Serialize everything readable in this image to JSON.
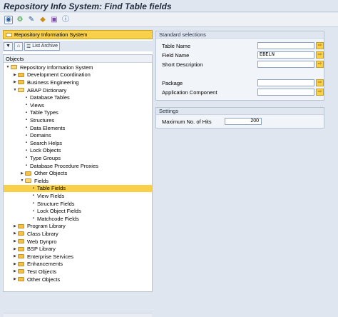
{
  "window": {
    "title": "Repository Info System: Find Table fields"
  },
  "toolbar": {
    "buttons": [
      {
        "icon": "execute-icon"
      },
      {
        "icon": "connections-icon"
      },
      {
        "icon": "display-toggle-icon"
      },
      {
        "icon": "other-object-icon"
      },
      {
        "icon": "where-used-icon"
      },
      {
        "icon": "info-icon"
      }
    ]
  },
  "nav": {
    "header_label": "Repository Information System",
    "list_archive_label": "List Archive"
  },
  "tree": {
    "title": "Objects",
    "items": [
      {
        "label": "Repository Information System",
        "level": 0,
        "type": "folder",
        "expanded": true
      },
      {
        "label": "Development Coordination",
        "level": 1,
        "type": "folder",
        "expanded": false
      },
      {
        "label": "Business Engineering",
        "level": 1,
        "type": "folder",
        "expanded": false
      },
      {
        "label": "ABAP Dictionary",
        "level": 1,
        "type": "folder",
        "expanded": true
      },
      {
        "label": "Database Tables",
        "level": 2,
        "type": "leaf"
      },
      {
        "label": "Views",
        "level": 2,
        "type": "leaf"
      },
      {
        "label": "Table Types",
        "level": 2,
        "type": "leaf"
      },
      {
        "label": "Structures",
        "level": 2,
        "type": "leaf"
      },
      {
        "label": "Data Elements",
        "level": 2,
        "type": "leaf"
      },
      {
        "label": "Domains",
        "level": 2,
        "type": "leaf"
      },
      {
        "label": "Search Helps",
        "level": 2,
        "type": "leaf"
      },
      {
        "label": "Lock Objects",
        "level": 2,
        "type": "leaf"
      },
      {
        "label": "Type Groups",
        "level": 2,
        "type": "leaf"
      },
      {
        "label": "Database Procedure Proxies",
        "level": 2,
        "type": "leaf"
      },
      {
        "label": "Other Objects",
        "level": 2,
        "type": "folder",
        "expanded": false
      },
      {
        "label": "Fields",
        "level": 2,
        "type": "folder",
        "expanded": true
      },
      {
        "label": "Table Fields",
        "level": 3,
        "type": "leaf",
        "selected": true
      },
      {
        "label": "View Fields",
        "level": 3,
        "type": "leaf"
      },
      {
        "label": "Structure Fields",
        "level": 3,
        "type": "leaf"
      },
      {
        "label": "Lock Object Fields",
        "level": 3,
        "type": "leaf"
      },
      {
        "label": "Matchcode Fields",
        "level": 3,
        "type": "leaf"
      },
      {
        "label": "Program Library",
        "level": 1,
        "type": "folder",
        "expanded": false
      },
      {
        "label": "Class Library",
        "level": 1,
        "type": "folder",
        "expanded": false
      },
      {
        "label": "Web Dynpro",
        "level": 1,
        "type": "folder",
        "expanded": false
      },
      {
        "label": "BSP Library",
        "level": 1,
        "type": "folder",
        "expanded": false
      },
      {
        "label": "Enterprise Services",
        "level": 1,
        "type": "folder",
        "expanded": false
      },
      {
        "label": "Enhancements",
        "level": 1,
        "type": "folder",
        "expanded": false
      },
      {
        "label": "Test Objects",
        "level": 1,
        "type": "folder",
        "expanded": false
      },
      {
        "label": "Other Objects",
        "level": 1,
        "type": "folder",
        "expanded": false
      }
    ]
  },
  "standard": {
    "title": "Standard selections",
    "table_name": {
      "label": "Table Name",
      "value": ""
    },
    "field_name": {
      "label": "Field Name",
      "value": "EBELN"
    },
    "short_description": {
      "label": "Short Description",
      "value": ""
    },
    "package": {
      "label": "Package",
      "value": ""
    },
    "application_component": {
      "label": "Application Component",
      "value": ""
    }
  },
  "settings": {
    "title": "Settings",
    "max_hits": {
      "label": "Maximum No. of Hits",
      "value": "200"
    }
  },
  "colors": {
    "accent_yellow": "#f9d04a",
    "background": "#dfe6ef",
    "title_text": "#1f2a3c"
  }
}
